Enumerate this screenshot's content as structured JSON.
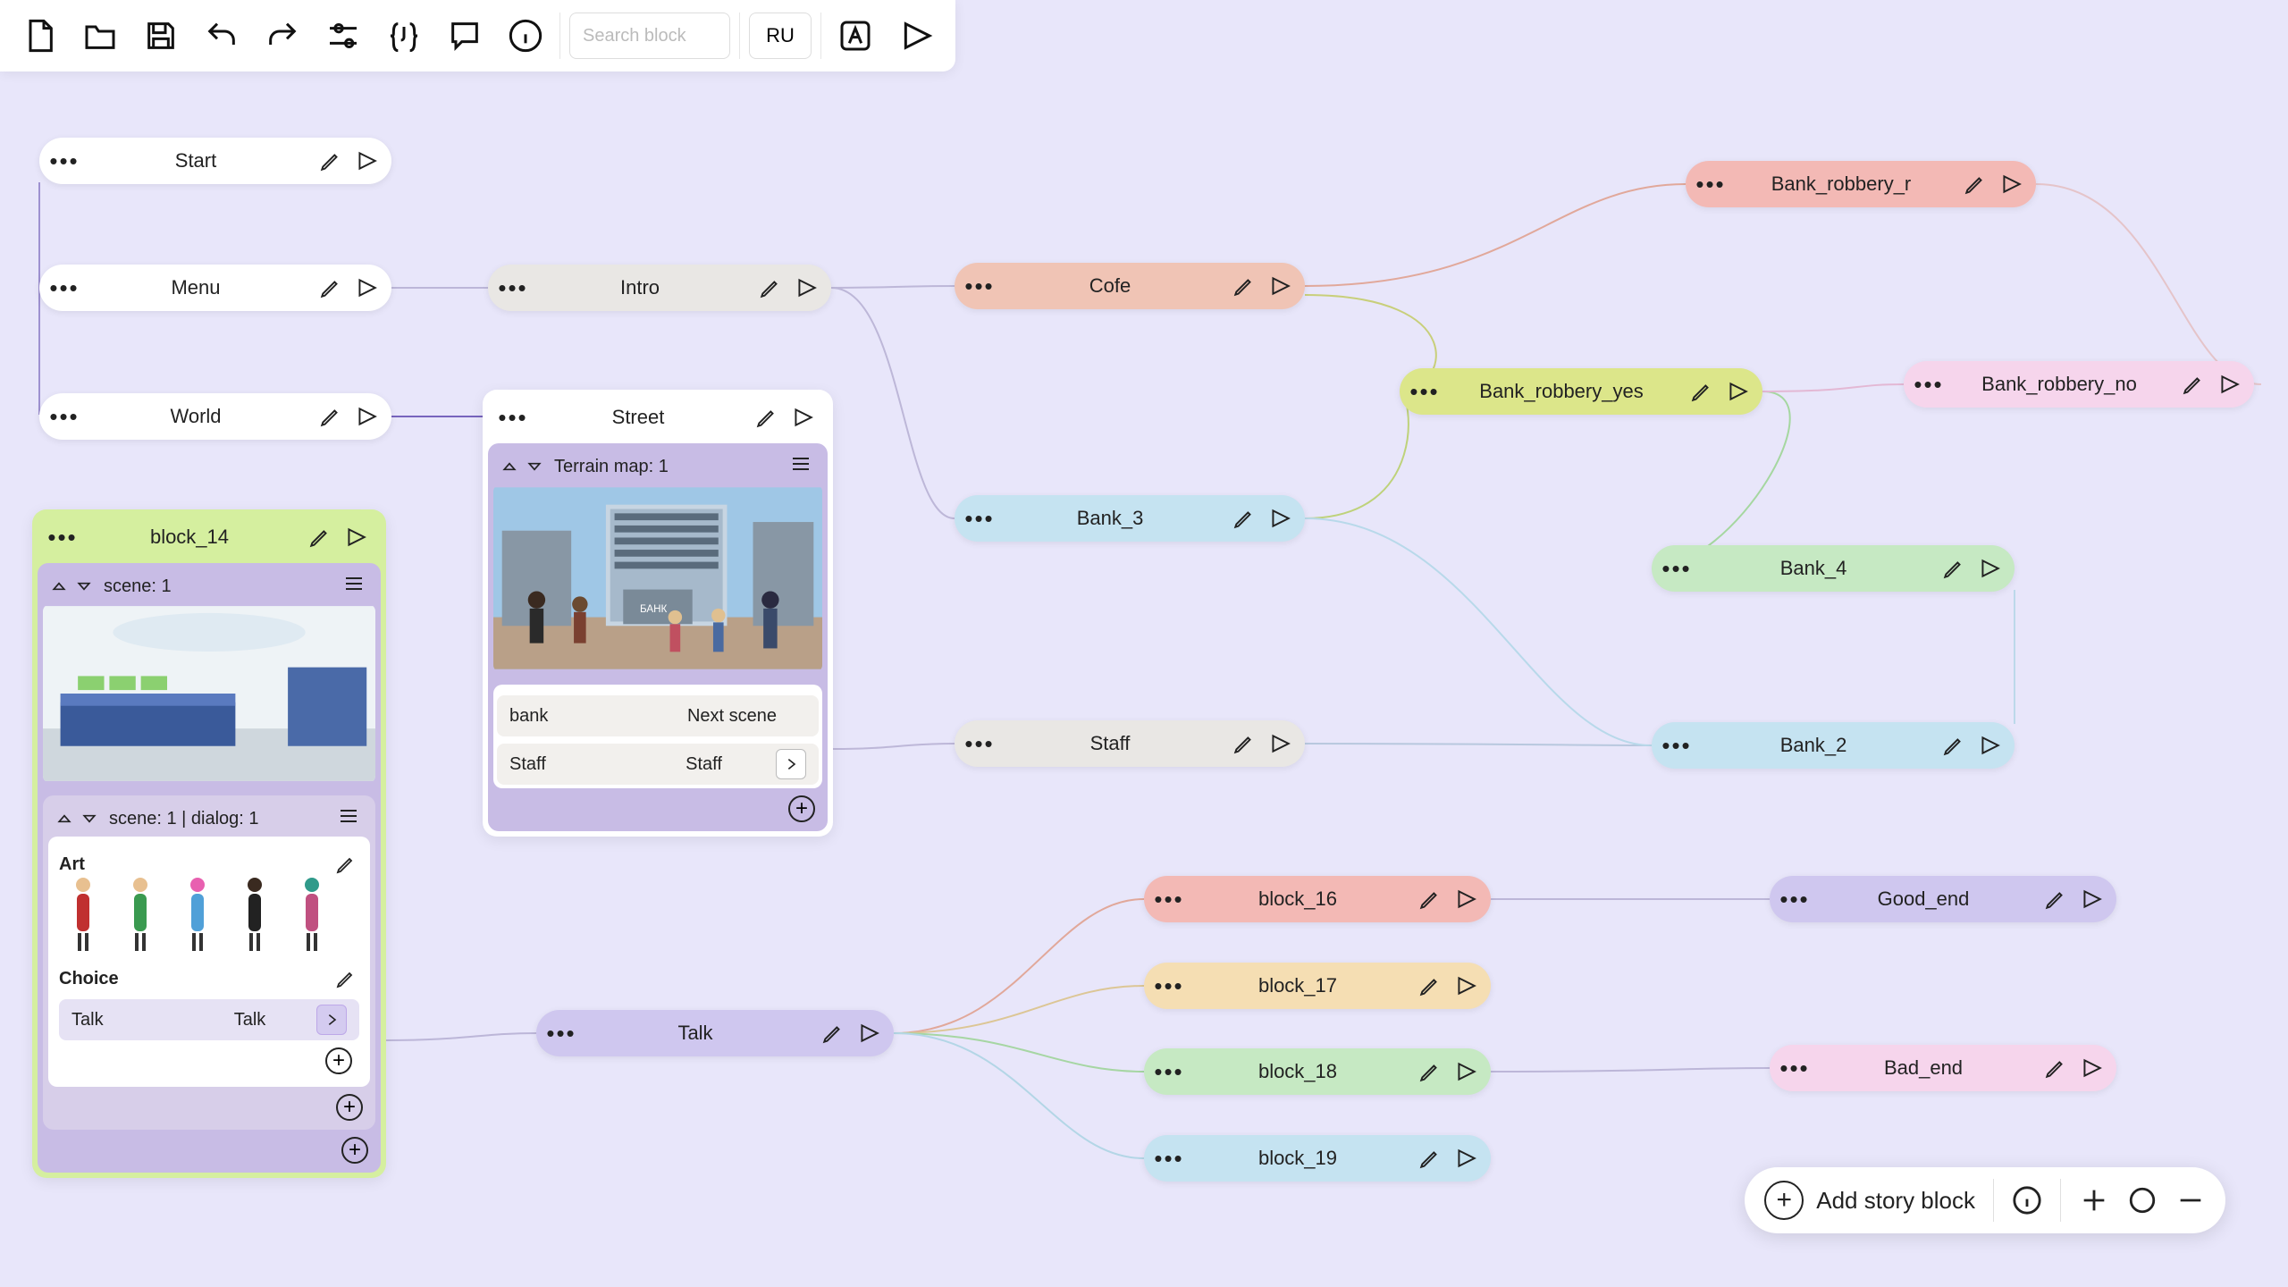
{
  "toolbar": {
    "search_placeholder": "Search block",
    "lang": "RU"
  },
  "nodes": {
    "start": "Start",
    "menu": "Menu",
    "world": "World",
    "intro": "Intro",
    "cofe": "Cofe",
    "bank3": "Bank_3",
    "staff": "Staff",
    "bank_rob_r": "Bank_robbery_r",
    "bank_rob_yes": "Bank_robbery_yes",
    "bank_rob_no": "Bank_robbery_no",
    "bank4": "Bank_4",
    "bank2": "Bank_2",
    "talk": "Talk",
    "b16": "block_16",
    "b17": "block_17",
    "b18": "block_18",
    "b19": "block_19",
    "good_end": "Good_end",
    "bad_end": "Bad_end"
  },
  "block14": {
    "title": "block_14",
    "scene_label": "scene: 1",
    "dialog_label": "scene: 1 | dialog: 1",
    "art_title": "Art",
    "choice_title": "Choice",
    "choice_left": "Talk",
    "choice_right": "Talk"
  },
  "street": {
    "title": "Street",
    "terrain_label": "Terrain map: 1",
    "row1_left": "bank",
    "row1_right": "Next scene",
    "row2_left": "Staff",
    "row2_right": "Staff"
  },
  "bottom": {
    "add_label": "Add story block"
  }
}
